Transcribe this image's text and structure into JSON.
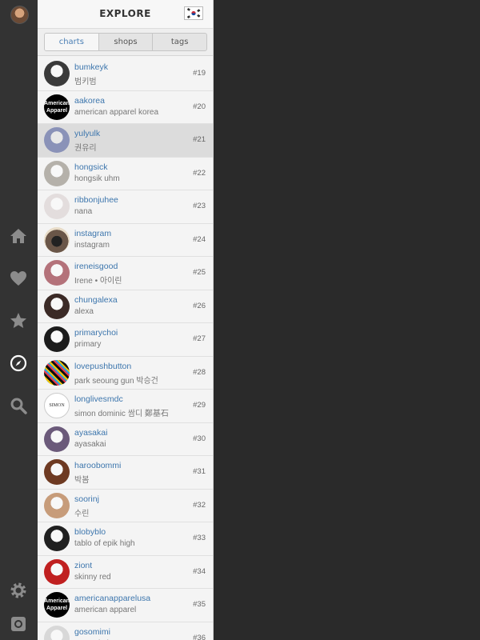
{
  "header": {
    "title": "EXPLORE",
    "flag": "korea-flag-icon"
  },
  "tabs": [
    {
      "label": "charts",
      "active": true
    },
    {
      "label": "shops",
      "active": false
    },
    {
      "label": "tags",
      "active": false
    }
  ],
  "rail_icons": [
    "home-icon",
    "heart-icon",
    "star-icon",
    "compass-icon",
    "search-icon",
    "settings-icon",
    "camera-icon"
  ],
  "rows": [
    {
      "user": "bumkeyk",
      "name": "범키범",
      "rank": "#19",
      "avatar": "photo",
      "color": "#3a3a3a",
      "selected": false
    },
    {
      "user": "aakorea",
      "name": "american apparel korea",
      "rank": "#20",
      "avatar": "american-apparel-logo",
      "color": "#000000",
      "selected": false
    },
    {
      "user": "yulyulk",
      "name": "권유리",
      "rank": "#21",
      "avatar": "photo",
      "color": "#8a92b8",
      "selected": true
    },
    {
      "user": "hongsick",
      "name": "hongsik uhm",
      "rank": "#22",
      "avatar": "photo",
      "color": "#b5b1aa",
      "selected": false
    },
    {
      "user": "ribbonjuhee",
      "name": "nana",
      "rank": "#23",
      "avatar": "photo",
      "color": "#e3dddd",
      "selected": false
    },
    {
      "user": "instagram",
      "name": "instagram",
      "rank": "#24",
      "avatar": "instagram-logo",
      "color": "#6a5648",
      "selected": false
    },
    {
      "user": "ireneisgood",
      "name": "Irene • 아이린",
      "rank": "#25",
      "avatar": "photo",
      "color": "#b4727a",
      "selected": false
    },
    {
      "user": "chungalexa",
      "name": "alexa",
      "rank": "#26",
      "avatar": "photo",
      "color": "#3b2a26",
      "selected": false
    },
    {
      "user": "primarychoi",
      "name": "primary",
      "rank": "#27",
      "avatar": "photo",
      "color": "#1c1c1c",
      "selected": false
    },
    {
      "user": "lovepushbutton",
      "name": "park seoung gun 박승건",
      "rank": "#28",
      "avatar": "pattern",
      "color": "#b02a8c",
      "selected": false
    },
    {
      "user": "longlivesmdc",
      "name": "simon dominic 쌈디 鄭基石",
      "rank": "#29",
      "avatar": "simon-logo",
      "color": "#ffffff",
      "selected": false
    },
    {
      "user": "ayasakai",
      "name": "ayasakai",
      "rank": "#30",
      "avatar": "photo",
      "color": "#6b5a7a",
      "selected": false
    },
    {
      "user": "haroobommi",
      "name": "박봄",
      "rank": "#31",
      "avatar": "photo",
      "color": "#6e3a22",
      "selected": false
    },
    {
      "user": "soorinj",
      "name": "수린",
      "rank": "#32",
      "avatar": "photo",
      "color": "#c79c7a",
      "selected": false
    },
    {
      "user": "blobyblo",
      "name": "tablo of epik high",
      "rank": "#33",
      "avatar": "photo",
      "color": "#202020",
      "selected": false
    },
    {
      "user": "ziont",
      "name": "skinny red",
      "rank": "#34",
      "avatar": "photo",
      "color": "#c02020",
      "selected": false
    },
    {
      "user": "americanapparelusa",
      "name": "american apparel",
      "rank": "#35",
      "avatar": "american-apparel-logo",
      "color": "#000000",
      "selected": false
    },
    {
      "user": "gosomimi",
      "name": "gosomimi",
      "rank": "#36",
      "avatar": "photo",
      "color": "#d8d8d8",
      "selected": false
    }
  ],
  "aa_logo_text": "American Apparel",
  "simon_logo_text": "SIMON"
}
